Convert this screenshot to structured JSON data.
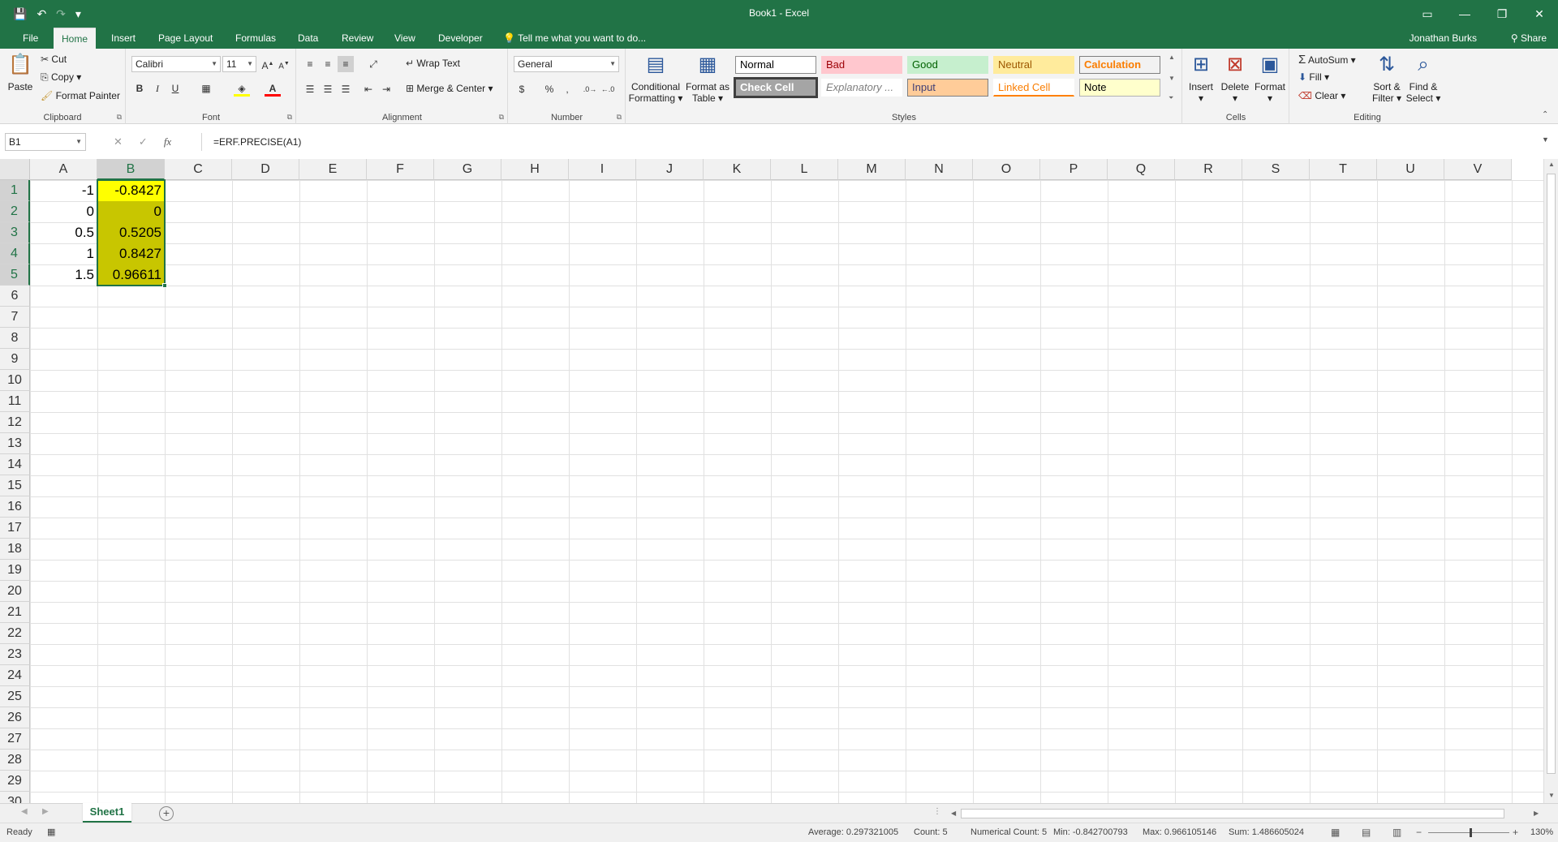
{
  "window": {
    "title": "Book1 - Excel",
    "qat": {
      "save_icon": "💾",
      "undo_icon": "↶",
      "redo_icon": "↷",
      "customize_icon": "▾"
    },
    "controls": {
      "ribbon_opts_icon": "▭",
      "minimize_icon": "—",
      "restore_icon": "❐",
      "close_icon": "✕"
    }
  },
  "tabs": [
    "File",
    "Home",
    "Insert",
    "Page Layout",
    "Formulas",
    "Data",
    "Review",
    "View",
    "Developer"
  ],
  "active_tab": "Home",
  "tell_me": "Tell me what you want to do...",
  "user": "Jonathan Burks",
  "share": "Share",
  "ribbon": {
    "clipboard": {
      "name": "Clipboard",
      "paste": "Paste",
      "cut": "Cut",
      "copy": "Copy",
      "format_painter": "Format Painter"
    },
    "font": {
      "name": "Font",
      "font_name": "Calibri",
      "font_size": "11",
      "bold": "B",
      "italic": "I",
      "underline": "U"
    },
    "alignment": {
      "name": "Alignment",
      "wrap_text": "Wrap Text",
      "merge_center": "Merge & Center"
    },
    "number": {
      "name": "Number",
      "format": "General",
      "currency": "$",
      "percent": "%",
      "comma": ","
    },
    "styles": {
      "name": "Styles",
      "conditional_formatting": [
        "Conditional",
        "Formatting"
      ],
      "format_as_table": [
        "Format as",
        "Table"
      ],
      "cells": [
        {
          "label": "Normal",
          "bg": "#ffffff",
          "fg": "#000000",
          "border": "#8a8a8a"
        },
        {
          "label": "Bad",
          "bg": "#ffc7ce",
          "fg": "#9c0006",
          "border": "#ffc7ce"
        },
        {
          "label": "Good",
          "bg": "#c6efce",
          "fg": "#006100",
          "border": "#c6efce"
        },
        {
          "label": "Neutral",
          "bg": "#ffeb9c",
          "fg": "#9c5700",
          "border": "#ffeb9c"
        },
        {
          "label": "Calculation",
          "bg": "#f2f2f2",
          "fg": "#fa7d00",
          "border": "#7f7f7f"
        },
        {
          "label": "Check Cell",
          "bg": "#a5a5a5",
          "fg": "#ffffff",
          "border": "#3f3f3f"
        },
        {
          "label": "Explanatory ...",
          "bg": "#ffffff",
          "fg": "#7f7f7f",
          "border": "#ffffff"
        },
        {
          "label": "Input",
          "bg": "#ffcc99",
          "fg": "#3f3f76",
          "border": "#7f7f7f"
        },
        {
          "label": "Linked Cell",
          "bg": "#ffffff",
          "fg": "#fa7d00",
          "border": "#ffffff"
        },
        {
          "label": "Note",
          "bg": "#ffffcc",
          "fg": "#000000",
          "border": "#b2b2b2"
        }
      ]
    },
    "cells_group": {
      "name": "Cells",
      "insert": "Insert",
      "delete": "Delete",
      "format": "Format"
    },
    "editing": {
      "name": "Editing",
      "autosum": "AutoSum",
      "fill": "Fill",
      "clear": "Clear",
      "sort_filter": [
        "Sort &",
        "Filter"
      ],
      "find_select": [
        "Find &",
        "Select"
      ]
    }
  },
  "formula_bar": {
    "name_box": "B1",
    "formula": "=ERF.PRECISE(A1)",
    "cancel_icon": "✕",
    "enter_icon": "✓",
    "fx_icon": "fx"
  },
  "grid": {
    "columns": [
      "A",
      "B",
      "C",
      "D",
      "E",
      "F",
      "G",
      "H",
      "I",
      "J",
      "K",
      "L",
      "M",
      "N",
      "O",
      "P",
      "Q",
      "R",
      "S",
      "T",
      "U",
      "V"
    ],
    "rows": [
      "1",
      "2",
      "3",
      "4",
      "5",
      "6",
      "7",
      "8",
      "9",
      "10",
      "11",
      "12",
      "13",
      "14",
      "15",
      "16",
      "17",
      "18",
      "19",
      "20",
      "21",
      "22",
      "23",
      "24",
      "25",
      "26",
      "27",
      "28",
      "29",
      "30"
    ],
    "selected_column": "B",
    "selected_rows": [
      "1",
      "2",
      "3",
      "4",
      "5"
    ],
    "col_a": [
      "-1",
      "0",
      "0.5",
      "1",
      "1.5"
    ],
    "col_b": [
      "-0.8427",
      "0",
      "0.5205",
      "0.8427",
      "0.96611"
    ],
    "fill_colors": {
      "selection": "#c8c600",
      "active": "#ffff00"
    }
  },
  "sheets": [
    "Sheet1"
  ],
  "status": {
    "ready": "Ready",
    "average": "Average: 0.297321005",
    "count": "Count: 5",
    "numerical_count": "Numerical Count: 5",
    "min": "Min: -0.842700793",
    "max": "Max: 0.966105146",
    "sum": "Sum: 1.486605024",
    "zoom": "130%"
  }
}
